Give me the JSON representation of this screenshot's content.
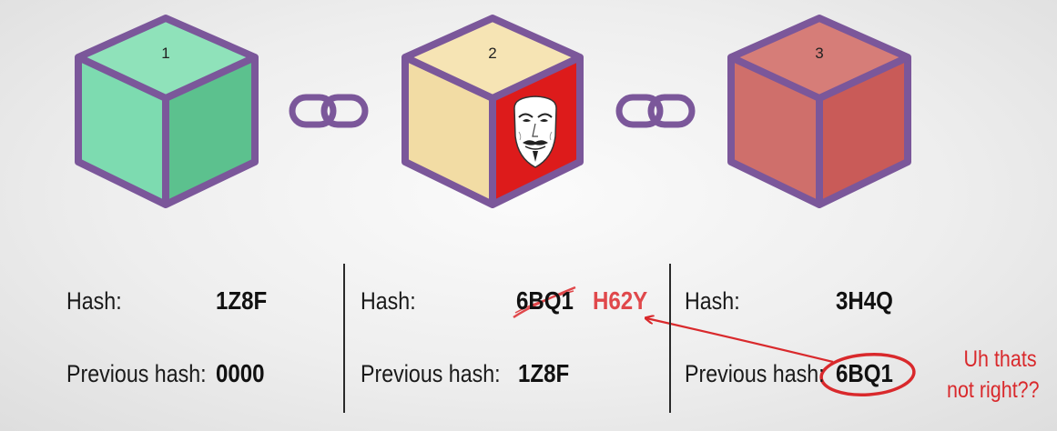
{
  "blocks": [
    {
      "number": "1",
      "hash_label": "Hash:",
      "hash": "1Z8F",
      "prev_label": "Previous hash:",
      "prev_hash": "0000",
      "colors": {
        "top": "#8fe2ba",
        "left": "#7ddbb0",
        "right": "#5cc18e"
      }
    },
    {
      "number": "2",
      "hash_label": "Hash:",
      "hash_old": "6BQ1",
      "hash_new": "H62Y",
      "prev_label": "Previous hash:",
      "prev_hash": "1Z8F",
      "colors": {
        "top": "#f6e4b4",
        "left": "#f2dca4",
        "right": "#dd1b1b"
      }
    },
    {
      "number": "3",
      "hash_label": "Hash:",
      "hash": "3H4Q",
      "prev_label": "Previous hash:",
      "prev_hash": "6BQ1",
      "colors": {
        "top": "#d67d78",
        "left": "#cf6f6b",
        "right": "#c95b58"
      }
    }
  ],
  "annotation": {
    "line1": "Uh thats",
    "line2": "not right??"
  },
  "icons": [
    "chain-link-icon",
    "hacker-mask-icon"
  ],
  "colors": {
    "outline": "#7b579a",
    "annotation": "#d9292c",
    "new_hash": "#e0484b"
  }
}
